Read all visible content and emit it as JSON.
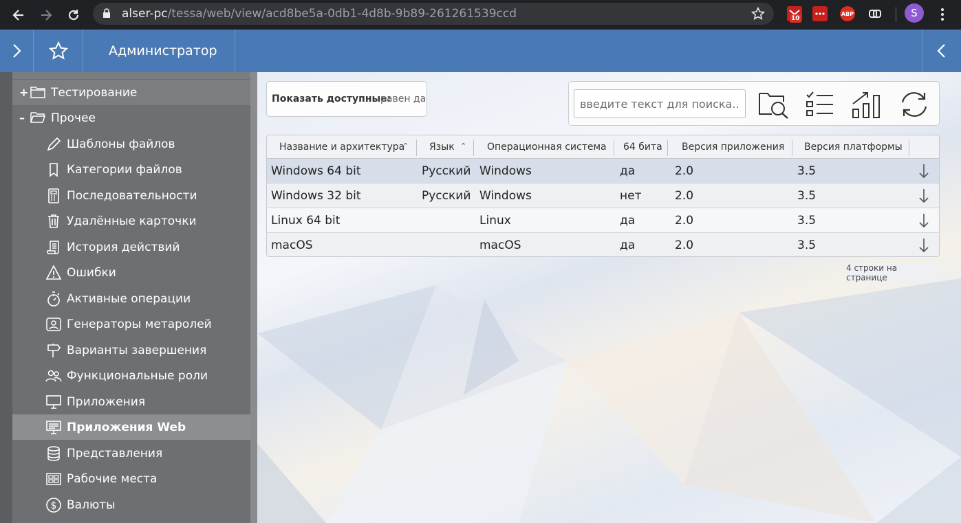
{
  "browser": {
    "url_host": "alser-pc",
    "url_path": "/tessa/web/view/acd8be5a-0db1-4d8b-9b89-261261539ccd",
    "gmail_badge": "10",
    "abp_label": "ABP",
    "avatar_letter": "S"
  },
  "header": {
    "title": "Администратор"
  },
  "sidebar": {
    "groups": [
      {
        "label": "Тестирование",
        "toggle": "+"
      },
      {
        "label": "Прочее",
        "toggle": "–"
      }
    ],
    "items": [
      {
        "label": "Шаблоны файлов",
        "icon": "pencil-icon"
      },
      {
        "label": "Категории файлов",
        "icon": "bookmark-icon"
      },
      {
        "label": "Последовательности",
        "icon": "calculator-icon"
      },
      {
        "label": "Удалённые карточки",
        "icon": "trash-icon"
      },
      {
        "label": "История действий",
        "icon": "scroll-icon"
      },
      {
        "label": "Ошибки",
        "icon": "warning-icon"
      },
      {
        "label": "Активные операции",
        "icon": "stopwatch-icon"
      },
      {
        "label": "Генераторы метаролей",
        "icon": "role-generator-icon"
      },
      {
        "label": "Варианты завершения",
        "icon": "signpost-icon"
      },
      {
        "label": "Функциональные роли",
        "icon": "users-icon"
      },
      {
        "label": "Приложения",
        "icon": "monitor-icon"
      },
      {
        "label": "Приложения Web",
        "icon": "web-app-icon"
      },
      {
        "label": "Представления",
        "icon": "database-icon"
      },
      {
        "label": "Рабочие места",
        "icon": "workplaces-icon"
      },
      {
        "label": "Валюты",
        "icon": "currency-icon"
      }
    ]
  },
  "filter": {
    "label": "Показать доступные:",
    "value": "равен да"
  },
  "search": {
    "placeholder": "введите текст для поиска..."
  },
  "grid": {
    "columns": [
      "Название и архитектура",
      "Язык",
      "Операционная система",
      "64 бита",
      "Версия приложения",
      "Версия платформы"
    ],
    "rows": [
      [
        "Windows 64 bit",
        "Русский",
        "Windows",
        "да",
        "2.0",
        "3.5"
      ],
      [
        "Windows 32 bit",
        "Русский",
        "Windows",
        "нет",
        "2.0",
        "3.5"
      ],
      [
        "Linux 64 bit",
        "",
        "Linux",
        "да",
        "2.0",
        "3.5"
      ],
      [
        "macOS",
        "",
        "macOS",
        "да",
        "2.0",
        "3.5"
      ]
    ]
  },
  "pager": {
    "text": "4 строки на странице"
  },
  "colors": {
    "chrome_bg": "#202124",
    "header_bg": "#4a7ab5",
    "sidebar_bg": "#6e6f73",
    "selected_row": "#d7deea"
  }
}
